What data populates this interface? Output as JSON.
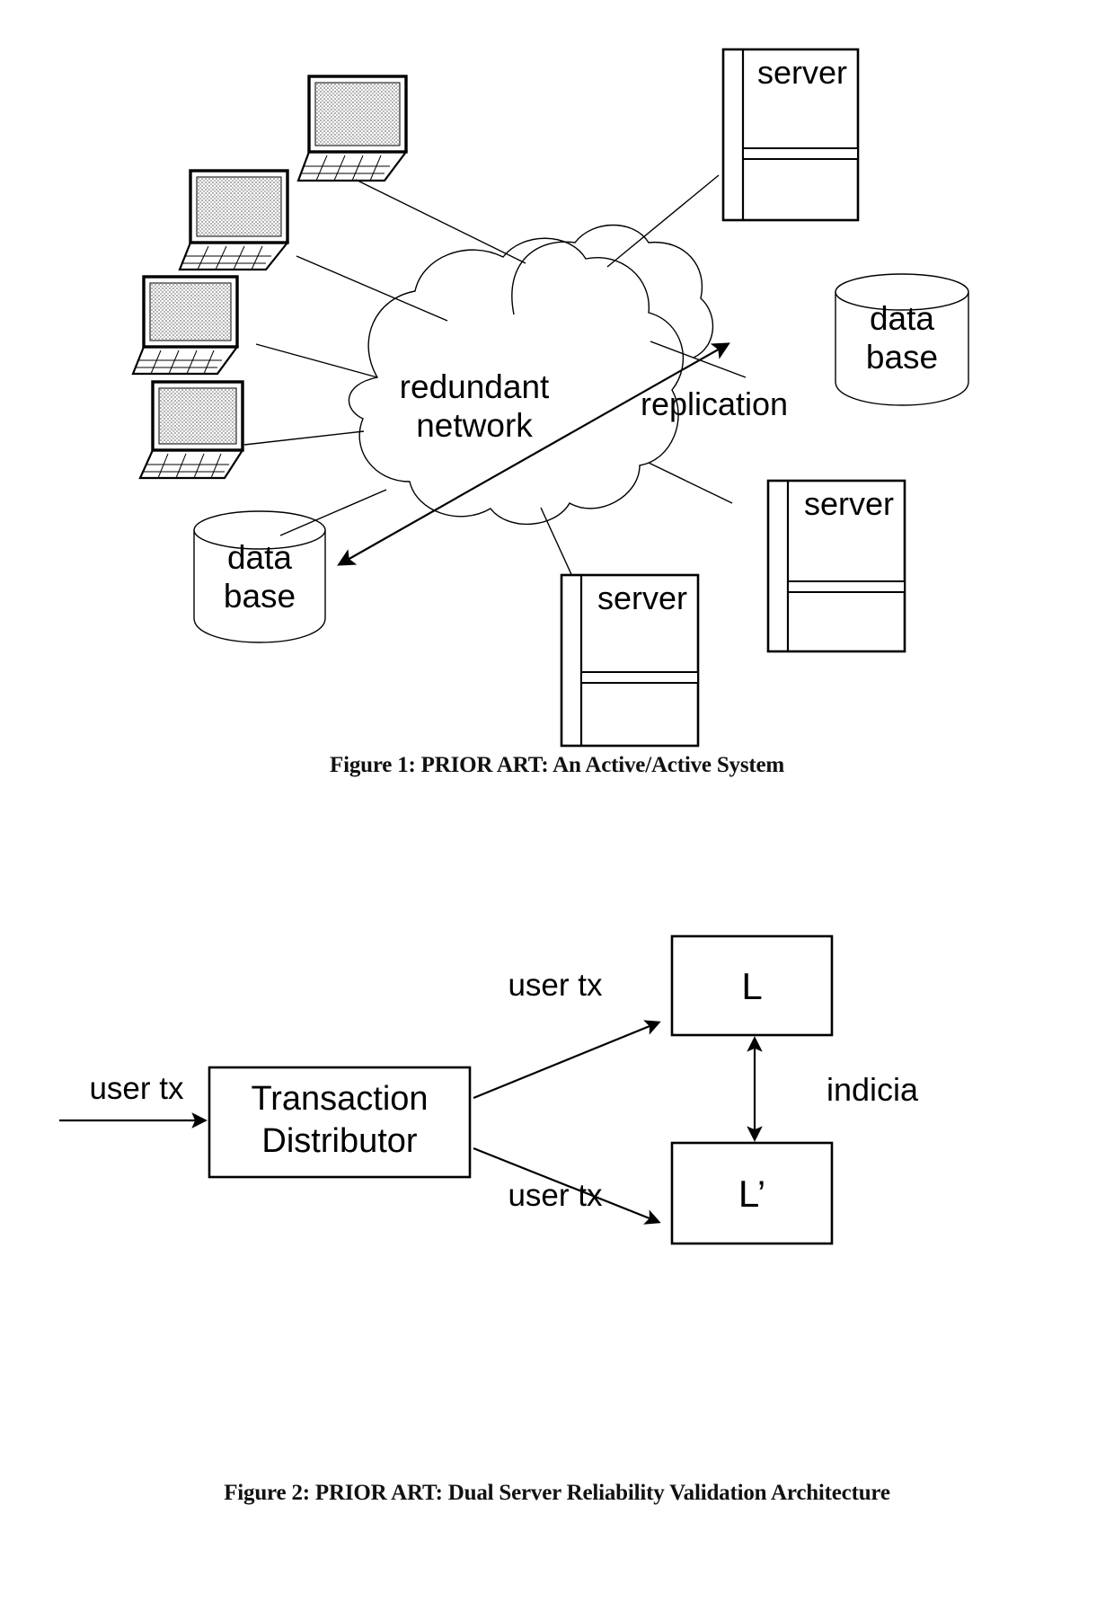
{
  "document": {
    "type": "patent-figure-sheet",
    "background_color": "#ffffff",
    "ink_color": "#000000"
  },
  "figure1": {
    "caption": "Figure 1: PRIOR ART: An Active/Active System",
    "cloud_label_line1": "redundant",
    "cloud_label_line2": "network",
    "replication_label": "replication",
    "servers": [
      {
        "id": "server-top-right",
        "label": "server"
      },
      {
        "id": "server-bottom-right",
        "label": "server"
      },
      {
        "id": "server-bottom-center",
        "label": "server"
      }
    ],
    "databases": [
      {
        "id": "database-right",
        "line1": "data",
        "line2": "base"
      },
      {
        "id": "database-left",
        "line1": "data",
        "line2": "base"
      }
    ],
    "clients": [
      {
        "id": "laptop-1"
      },
      {
        "id": "laptop-2"
      },
      {
        "id": "laptop-3"
      },
      {
        "id": "laptop-4"
      }
    ]
  },
  "figure2": {
    "caption": "Figure 2: PRIOR ART: Dual Server Reliability Validation Architecture",
    "input_label": "user tx",
    "distributor_line1": "Transaction",
    "distributor_line2": "Distributor",
    "branch_top_label": "user tx",
    "branch_bottom_label": "user tx",
    "node_top_label": "L",
    "node_bottom_label": "L’",
    "link_label": "indicia"
  }
}
